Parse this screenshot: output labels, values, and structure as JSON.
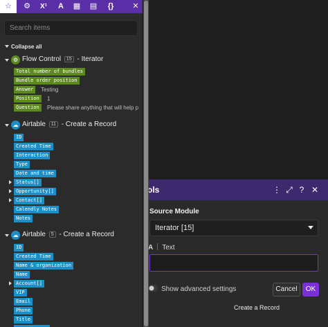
{
  "tabs": [
    {
      "icon": "star-icon",
      "glyph": "☆"
    },
    {
      "icon": "gear-icon",
      "glyph": "⚙"
    },
    {
      "icon": "math-icon",
      "glyph": "X¹"
    },
    {
      "icon": "text-icon",
      "glyph": "A"
    },
    {
      "icon": "calendar-icon",
      "glyph": "▦"
    },
    {
      "icon": "table-icon",
      "glyph": "▤"
    },
    {
      "icon": "braces-icon",
      "glyph": "{}"
    },
    {
      "icon": "close-icon",
      "glyph": "✕"
    }
  ],
  "search": {
    "placeholder": "Search items"
  },
  "collapse_all": "Collapse all",
  "modules": [
    {
      "name": "Flow Control",
      "badge": "15",
      "suffix": "- Iterator",
      "icon": "gear-icon",
      "icon_color": "#5c8a1f",
      "items": [
        {
          "label": "Total number of bundles",
          "value": ""
        },
        {
          "label": "Bundle order position",
          "value": ""
        },
        {
          "label": "Answer",
          "value": "Testing"
        },
        {
          "label": "Position",
          "value": "1"
        },
        {
          "label": "Question",
          "value": "Please share anything that will help p"
        }
      ]
    },
    {
      "name": "Airtable",
      "badge": "11",
      "suffix": "- Create a Record",
      "icon": "airtable-icon",
      "icon_color": "#1e8fc6",
      "items": [
        {
          "label": "ID",
          "expandable": false
        },
        {
          "label": "Created Time",
          "expandable": false
        },
        {
          "label": "Interaction",
          "expandable": false
        },
        {
          "label": "Type",
          "expandable": false
        },
        {
          "label": "Date and time",
          "expandable": false
        },
        {
          "label": "Status[]",
          "expandable": true
        },
        {
          "label": "Opportunity[]",
          "expandable": true
        },
        {
          "label": "Contact[]",
          "expandable": true
        },
        {
          "label": "Calendly Notes",
          "expandable": false
        },
        {
          "label": "Notes",
          "expandable": false
        }
      ]
    },
    {
      "name": "Airtable",
      "badge": "5",
      "suffix": "- Create a Record",
      "icon": "airtable-icon",
      "icon_color": "#1e8fc6",
      "items": [
        {
          "label": "ID",
          "expandable": false
        },
        {
          "label": "Created Time",
          "expandable": false
        },
        {
          "label": "Name & organization",
          "expandable": false
        },
        {
          "label": "Name",
          "expandable": false
        },
        {
          "label": "Account[]",
          "expandable": true
        },
        {
          "label": "VIP",
          "expandable": false
        },
        {
          "label": "Email",
          "expandable": false
        },
        {
          "label": "Phone",
          "expandable": false
        },
        {
          "label": "Title",
          "expandable": false
        }
      ]
    }
  ],
  "dialog": {
    "title": "ols",
    "source_module_label": "Source Module",
    "source_module_value": "Iterator [15]",
    "type_icon": "A",
    "type_label": "Text",
    "advanced_label": "Show advanced settings",
    "cancel_label": "Cancel",
    "ok_label": "OK",
    "header_icons": [
      "more-vertical-icon",
      "expand-icon",
      "help-icon",
      "close-icon"
    ]
  },
  "module_caption": "Create a Record",
  "colors": {
    "accent_purple": "#5b2fa8",
    "ok_purple": "#7a2fd8",
    "chip_green": "#5c8a1f",
    "chip_blue": "#1e8fc6"
  }
}
